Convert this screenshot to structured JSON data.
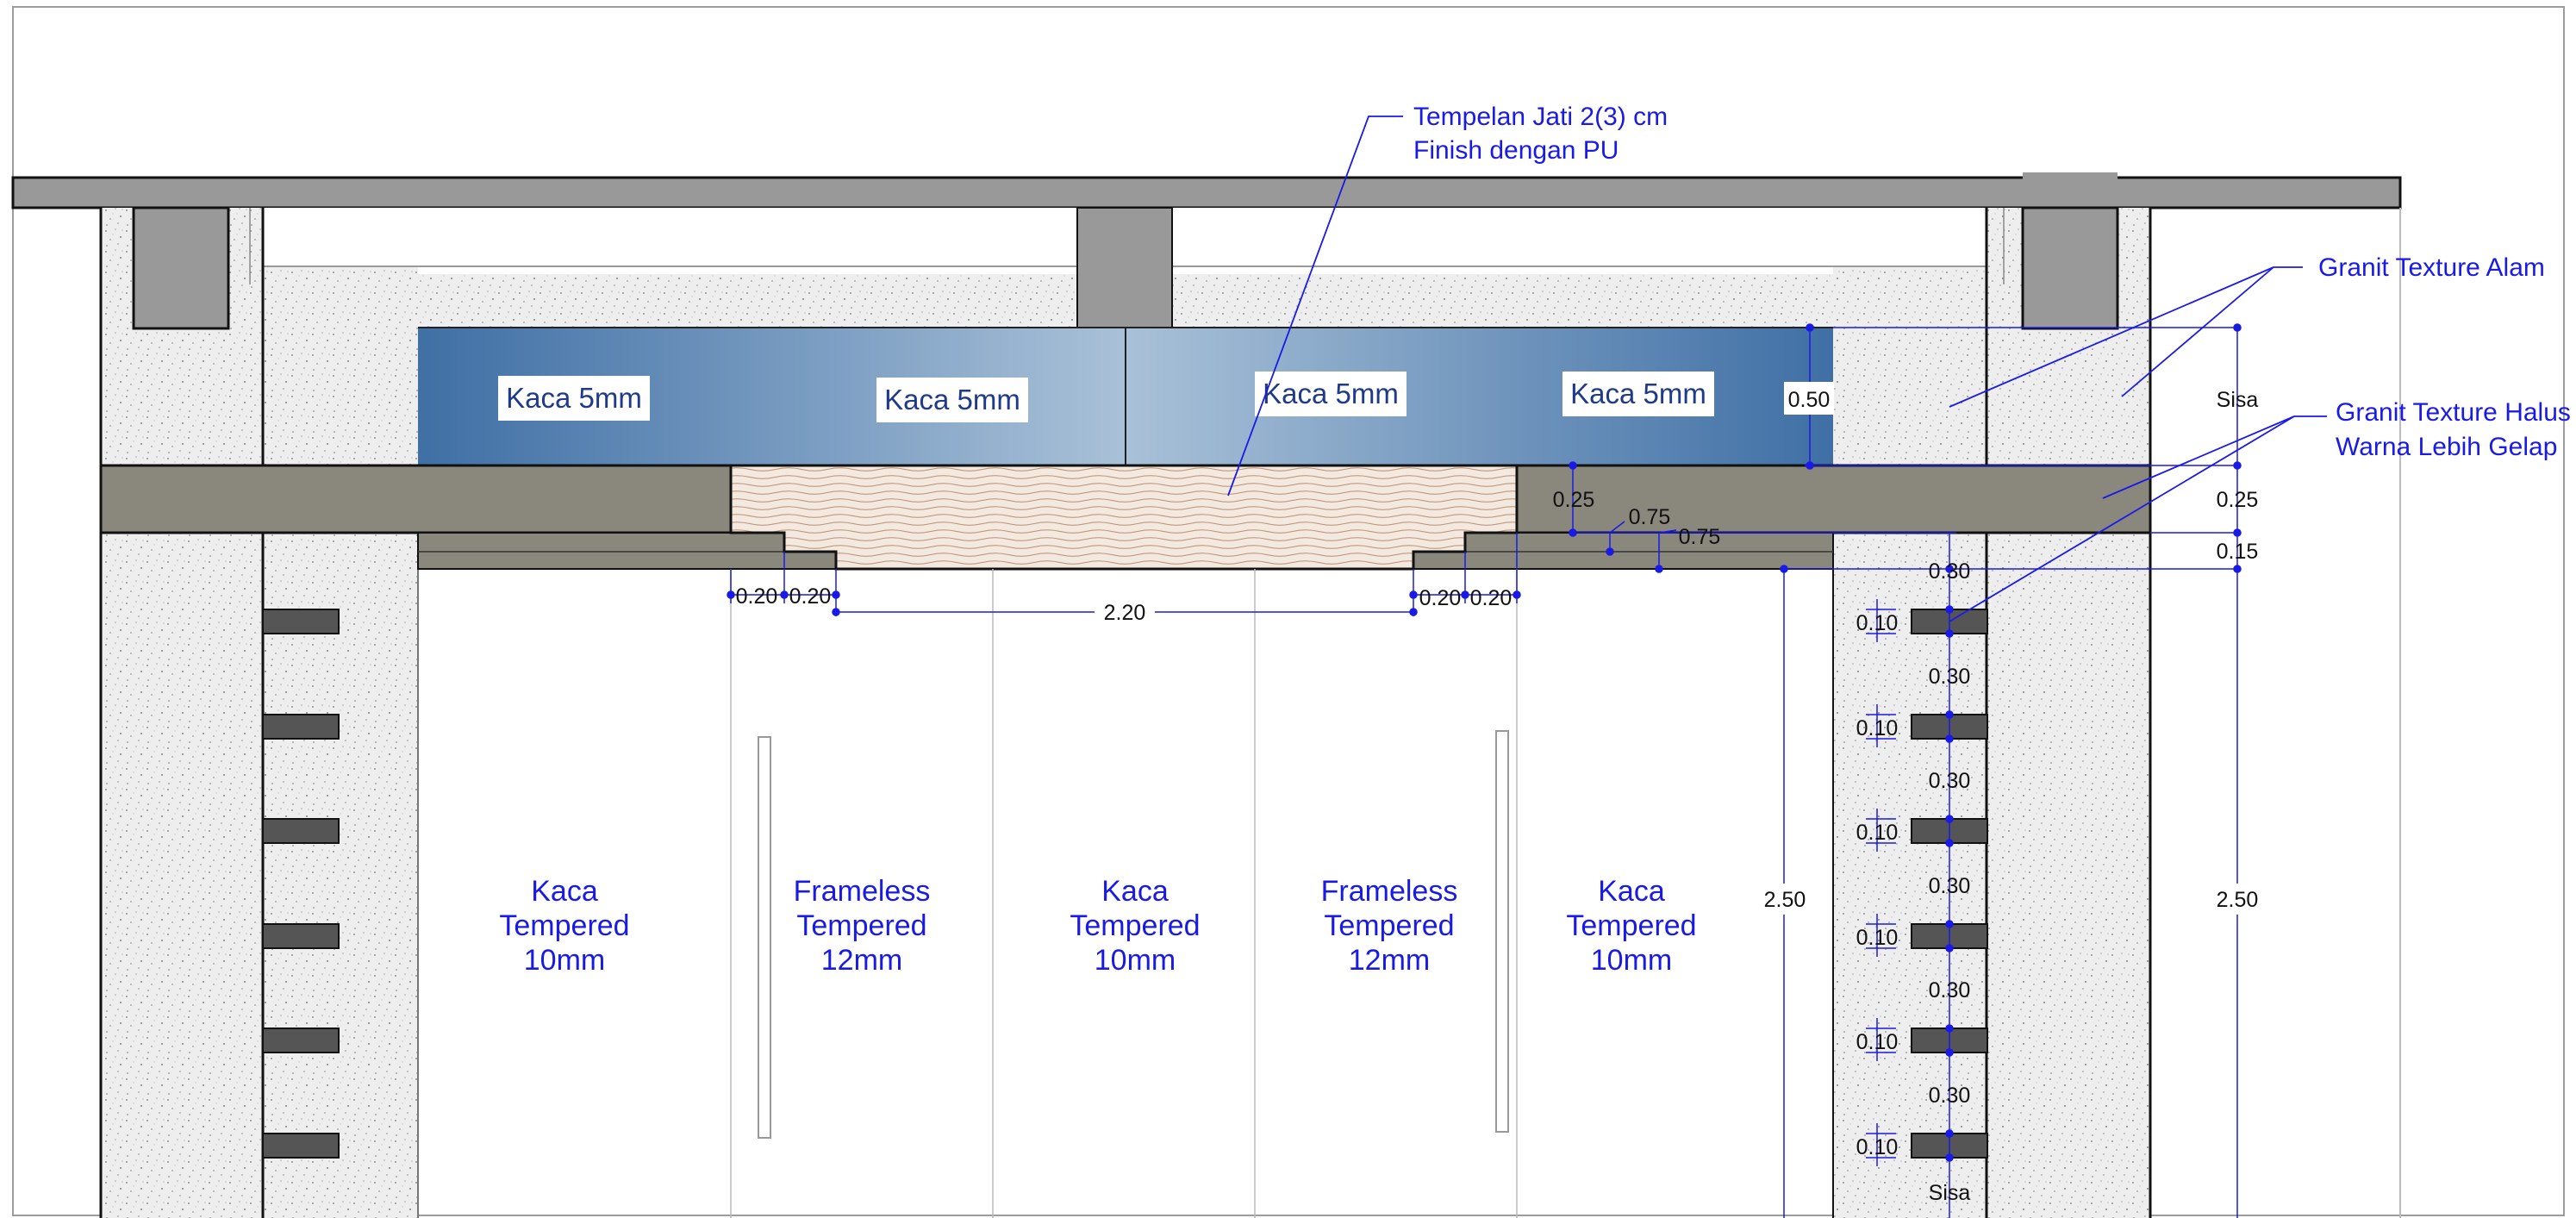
{
  "callouts": {
    "teak_line1": "Tempelan Jati 2(3) cm",
    "teak_line2": "Finish dengan PU",
    "granite_natural": "Granit Texture Alam",
    "granite_fine_line1": "Granit Texture Halus",
    "granite_fine_line2": "Warna Lebih Gelap"
  },
  "upper_glass_labels": [
    "Kaca 5mm",
    "Kaca 5mm",
    "Kaca 5mm",
    "Kaca 5mm"
  ],
  "door_panels": [
    {
      "line1": "Kaca",
      "line2": "Tempered",
      "line3": "10mm"
    },
    {
      "line1": "Frameless",
      "line2": "Tempered",
      "line3": "12mm"
    },
    {
      "line1": "Kaca",
      "line2": "Tempered",
      "line3": "10mm"
    },
    {
      "line1": "Frameless",
      "line2": "Tempered",
      "line3": "12mm"
    },
    {
      "line1": "Kaca",
      "line2": "Tempered",
      "line3": "10mm"
    }
  ],
  "dimensions": {
    "glass_height": "0.50",
    "sisa_top": "Sisa",
    "beam_height": "0.25",
    "beam_height_right": "0.25",
    "step_075_a": "0.75",
    "step_075_b": "0.75",
    "band_015": "0.15",
    "top_030": "0.30",
    "step_020": [
      "0.20",
      "0.20",
      "0.20",
      "0.20"
    ],
    "opening_width": "2.20",
    "door_height_left": "2.50",
    "door_height_right": "2.50",
    "slat_spacing": [
      "0.30",
      "0.30",
      "0.30",
      "0.30",
      "0.30"
    ],
    "slat_thickness": [
      "0.10",
      "0.10",
      "0.10",
      "0.10",
      "0.10",
      "0.10"
    ],
    "sisa_bottom": "Sisa"
  },
  "colors": {
    "annotation_blue": "#1a1ae6",
    "concrete_gray": "#999999",
    "beam_gray": "#8a877c",
    "slat_gray": "#555555",
    "glass_blue_dark": "#3f6fa5",
    "glass_blue_light": "#a9c1d8",
    "teak_fill": "#f3e9df",
    "granite_fill": "#eeeeee"
  }
}
